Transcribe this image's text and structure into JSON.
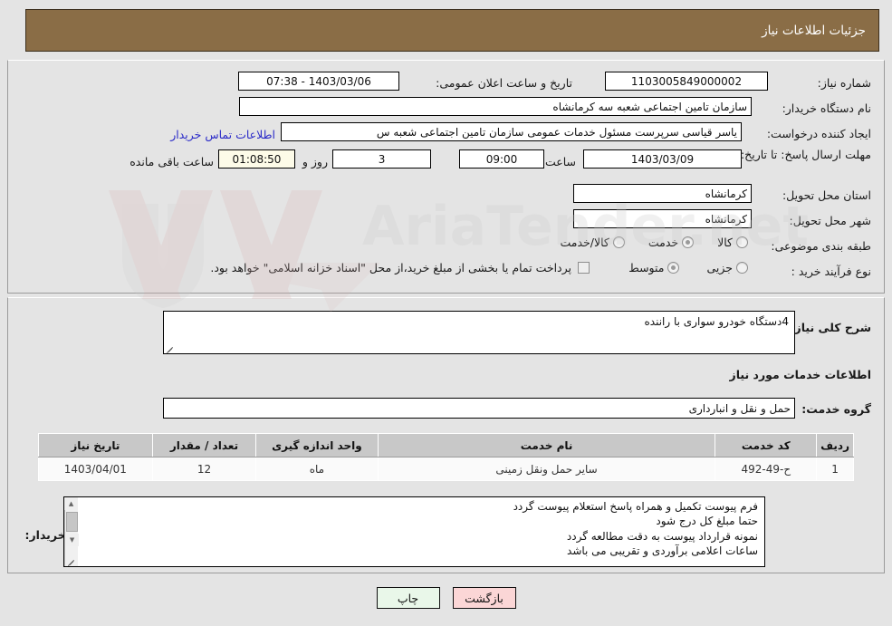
{
  "header": {
    "title": "جزئیات اطلاعات نیاز"
  },
  "form": {
    "need_number_label": "شماره نیاز:",
    "need_number_value": "1103005849000002",
    "announce_label": "تاریخ و ساعت اعلان عمومی:",
    "announce_value": "1403/03/06 - 07:38",
    "buyer_org_label": "نام دستگاه خریدار:",
    "buyer_org_value": "سازمان تامین اجتماعی شعبه سه کرمانشاه",
    "requester_label": "ایجاد کننده درخواست:",
    "requester_value": "یاسر قیاسی سرپرست مسئول خدمات عمومی سازمان تامین اجتماعی شعبه س",
    "contact_link": "اطلاعات تماس خریدار",
    "deadline_label": "مهلت ارسال پاسخ: تا تاریخ:",
    "deadline_date": "1403/03/09",
    "hour_label": "ساعت",
    "deadline_hour": "09:00",
    "days_value": "3",
    "days_label": "روز و",
    "countdown_value": "01:08:50",
    "remaining_label": "ساعت باقی مانده",
    "province_label": "استان محل تحویل:",
    "province_value": "کرمانشاه",
    "city_label": "شهر محل تحویل:",
    "city_value": "کرمانشاه",
    "category_label": "طبقه بندی موضوعی:",
    "category_options": [
      {
        "label": "کالا",
        "selected": false
      },
      {
        "label": "خدمت",
        "selected": true
      },
      {
        "label": "کالا/خدمت",
        "selected": false
      }
    ],
    "process_label": "نوع فرآیند خرید :",
    "process_options": [
      {
        "label": "جزیی",
        "selected": false
      },
      {
        "label": "متوسط",
        "selected": true
      }
    ],
    "payment_checkbox_label": "پرداخت تمام یا بخشی از مبلغ خرید،از محل \"اسناد خزانه اسلامی\" خواهد بود.",
    "payment_checked": false
  },
  "description": {
    "label": "شرح کلی نیاز:",
    "value": "4دستگاه خودرو سواری با راننده"
  },
  "services_section": {
    "heading": "اطلاعات خدمات مورد نیاز",
    "group_label": "گروه خدمت:",
    "group_value": "حمل و نقل و انبارداری"
  },
  "table": {
    "columns": [
      "ردیف",
      "کد خدمت",
      "نام خدمت",
      "واحد اندازه گیری",
      "تعداد / مقدار",
      "تاریخ نیاز"
    ],
    "rows": [
      {
        "radif": "1",
        "code": "ح-49-492",
        "name": "سایر حمل ونقل زمینی",
        "unit": "ماه",
        "qty": "12",
        "date": "1403/04/01"
      }
    ]
  },
  "notes": {
    "label": "توضیحات خریدار:",
    "lines": [
      "فرم پیوست تکمیل و همراه پاسخ استعلام پیوست گردد",
      "حتما مبلغ کل درج شود",
      "نمونه قرارداد پیوست به دقت مطالعه گردد",
      "ساعات اعلامی برآوردی و تقریبی می باشد"
    ]
  },
  "buttons": {
    "print": "چاپ",
    "back": "بازگشت"
  },
  "watermark": {
    "text": "AriaTender.net"
  },
  "colors": {
    "header_bg": "#8a6d46",
    "link": "#2b2bc8",
    "print_bg": "#e9f7e9",
    "back_bg": "#fbd6d6",
    "countdown_bg": "#fdfbe8"
  }
}
